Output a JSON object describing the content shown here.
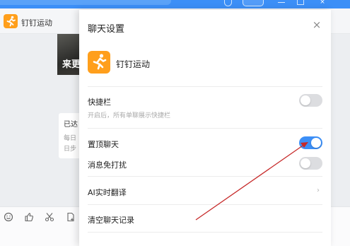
{
  "app": {
    "title": "钉钉运动"
  },
  "topbar": {
    "plus_label": "+",
    "close_label": "×"
  },
  "chat": {
    "name": "钉钉运动",
    "photo_text": "来更",
    "message_title": "已达",
    "message_line1": "每日",
    "message_line2": "日步"
  },
  "toolbar": {
    "icons": [
      "emoji-icon",
      "thumbs-up-icon",
      "scissors-icon",
      "attachment-icon"
    ]
  },
  "panel": {
    "title": "聊天设置",
    "close_label": "×",
    "app_name": "钉钉运动",
    "rows": [
      {
        "label": "快捷栏",
        "sublabel": "开启后，所有单聊展示快捷栏",
        "toggle": false
      },
      {
        "label": "置顶聊天",
        "toggle": true
      },
      {
        "label": "消息免打扰",
        "toggle": false
      },
      {
        "label": "AI实时翻译",
        "chevron": "›"
      },
      {
        "label": "清空聊天记录"
      }
    ]
  },
  "colors": {
    "accent": "#3c8ff7",
    "brand_orange": "#ff9f1c",
    "annotation": "#c62828"
  }
}
